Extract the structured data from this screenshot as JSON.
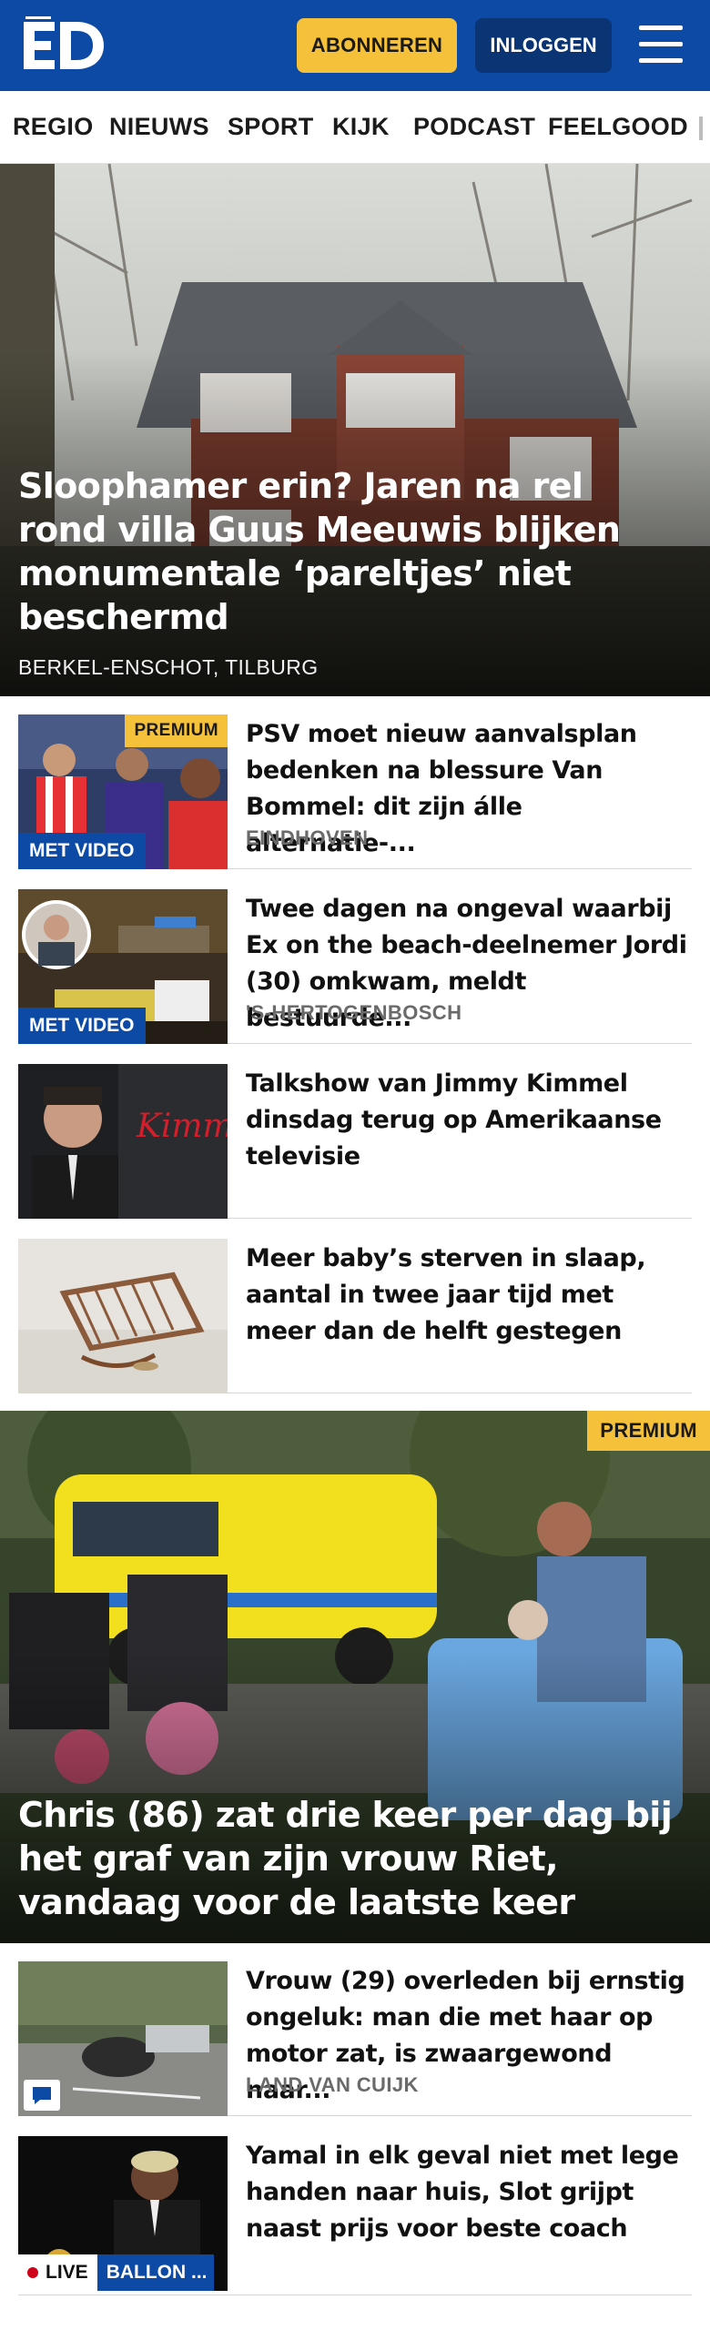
{
  "header": {
    "logo_text": "ED",
    "subscribe_label": "ABONNEREN",
    "login_label": "INLOGGEN"
  },
  "nav": {
    "items": [
      "REGIO",
      "NIEUWS",
      "SPORT",
      "KIJK",
      "PODCAST",
      "FEELGOOD"
    ]
  },
  "hero": {
    "title": "Sloophamer erin? Jaren na rel rond villa Guus Meeuwis blijken monumentale ‘pareltjes’ niet beschermd",
    "location": "BERKEL-ENSCHOT, TILBURG"
  },
  "articles": [
    {
      "title": "PSV moet nieuw aanvalsplan bedenken na blessure Van Bommel: dit zijn álle alternatie-...",
      "location": "EINDHOVEN",
      "badge": "MET VIDEO",
      "premium": "PREMIUM"
    },
    {
      "title": "Twee dagen na ongeval waarbij Ex on the beach-deelnemer Jordi (30) omkwam, meldt bestuurde...",
      "location": "'S-HERTOGENBOSCH",
      "badge": "MET VIDEO"
    },
    {
      "title": "Talkshow van Jimmy Kimmel dinsdag terug op Amerikaanse televisie"
    },
    {
      "title": "Meer baby’s sterven in slaap, aantal in twee jaar tijd met meer dan de helft gestegen"
    }
  ],
  "hero2": {
    "title": "Chris (86) zat drie keer per dag bij het graf van zijn vrouw Riet, vandaag voor de laatste keer",
    "premium": "PREMIUM"
  },
  "articles2": [
    {
      "title": "Vrouw (29) overleden bij ernstig ongeluk: man die met haar op motor zat, is zwaargewond naar...",
      "location": "LAND VAN CUIJK"
    },
    {
      "title": "Yamal in elk geval niet met lege handen naar huis, Slot grijpt naast prijs voor beste coach",
      "live": "LIVE",
      "tag": "BALLON ..."
    }
  ],
  "colors": {
    "brand_blue": "#0c4aa6",
    "accent_yellow": "#f5c13a",
    "login_blue": "#0a3474"
  }
}
